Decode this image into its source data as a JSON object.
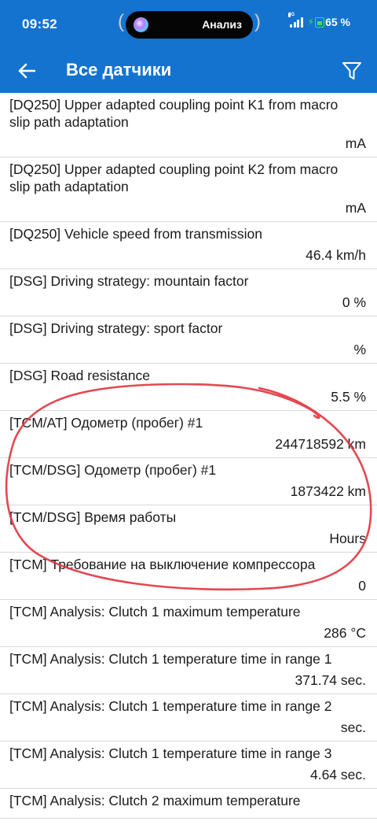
{
  "status_bar": {
    "time": "09:52",
    "island_label": "Анализ",
    "network_tag": "4G",
    "battery": "65 %"
  },
  "app_bar": {
    "title": "Все датчики",
    "back_icon": "arrow-left-icon",
    "filter_icon": "filter-icon"
  },
  "sensors": [
    {
      "name": "[DQ250] Upper adapted coupling point K1 from macro slip path adaptation",
      "value": "mA"
    },
    {
      "name": "[DQ250] Upper adapted coupling point K2 from macro slip path adaptation",
      "value": "mA"
    },
    {
      "name": "[DQ250] Vehicle speed from transmission",
      "value": "46.4 km/h"
    },
    {
      "name": "[DSG] Driving strategy: mountain factor",
      "value": "0 %"
    },
    {
      "name": "[DSG] Driving strategy: sport factor",
      "value": "%"
    },
    {
      "name": "[DSG] Road resistance",
      "value": "5.5 %"
    },
    {
      "name": "[TCM/AT] Одометр (пробег) #1",
      "value": "244718592 km"
    },
    {
      "name": "[TCM/DSG] Одометр (пробег) #1",
      "value": "1873422 km"
    },
    {
      "name": "[TCM/DSG] Время работы",
      "value": "Hours"
    },
    {
      "name": "[TCM] Требование на выключение компрессора",
      "value": "0"
    },
    {
      "name": "[TCM] Analysis: Clutch 1 maximum temperature",
      "value": "286 °C"
    },
    {
      "name": "[TCM] Analysis: Clutch 1 temperature time in range 1",
      "value": "371.74 sec."
    },
    {
      "name": "[TCM] Analysis: Clutch 1 temperature time in range 2",
      "value": "sec."
    },
    {
      "name": "[TCM] Analysis: Clutch 1 temperature time in range 3",
      "value": "4.64 sec."
    },
    {
      "name": "[TCM] Analysis: Clutch 2 maximum temperature",
      "value": ""
    }
  ],
  "colors": {
    "app_bar": "#1473cf",
    "annotation": "#e0353f",
    "divider": "#d9d9d9"
  }
}
